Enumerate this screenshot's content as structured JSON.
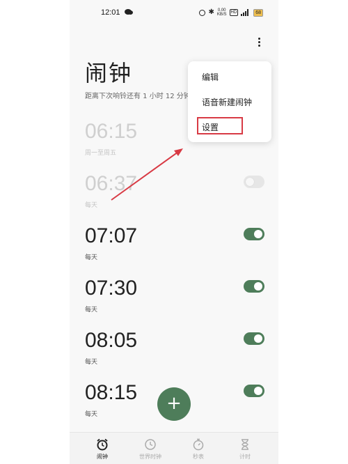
{
  "status_bar": {
    "time": "12:01",
    "speed_value": "0.00",
    "speed_unit": "KB/S",
    "hd_label": "HD",
    "battery": "68"
  },
  "header": {
    "title": "闹钟",
    "subtitle": "距离下次响铃还有 1 小时 12 分钟"
  },
  "alarms": [
    {
      "time": "06:15",
      "repeat": "周一至周五",
      "enabled": false
    },
    {
      "time": "06:37",
      "repeat": "每天",
      "enabled": false
    },
    {
      "time": "07:07",
      "repeat": "每天",
      "enabled": true
    },
    {
      "time": "07:30",
      "repeat": "每天",
      "enabled": true
    },
    {
      "time": "08:05",
      "repeat": "每天",
      "enabled": true
    },
    {
      "time": "08:15",
      "repeat": "每天",
      "enabled": true
    }
  ],
  "menu": {
    "items": [
      "编辑",
      "语音新建闹钟",
      "设置"
    ]
  },
  "fab_label": "+",
  "bottom_nav": [
    {
      "label": "闹钟",
      "icon": "alarm-clock-icon",
      "active": true
    },
    {
      "label": "世界时钟",
      "icon": "world-clock-icon",
      "active": false
    },
    {
      "label": "秒表",
      "icon": "stopwatch-icon",
      "active": false
    },
    {
      "label": "计时",
      "icon": "hourglass-icon",
      "active": false
    }
  ],
  "colors": {
    "accent": "#4e7d5a",
    "highlight": "#d83a44"
  }
}
